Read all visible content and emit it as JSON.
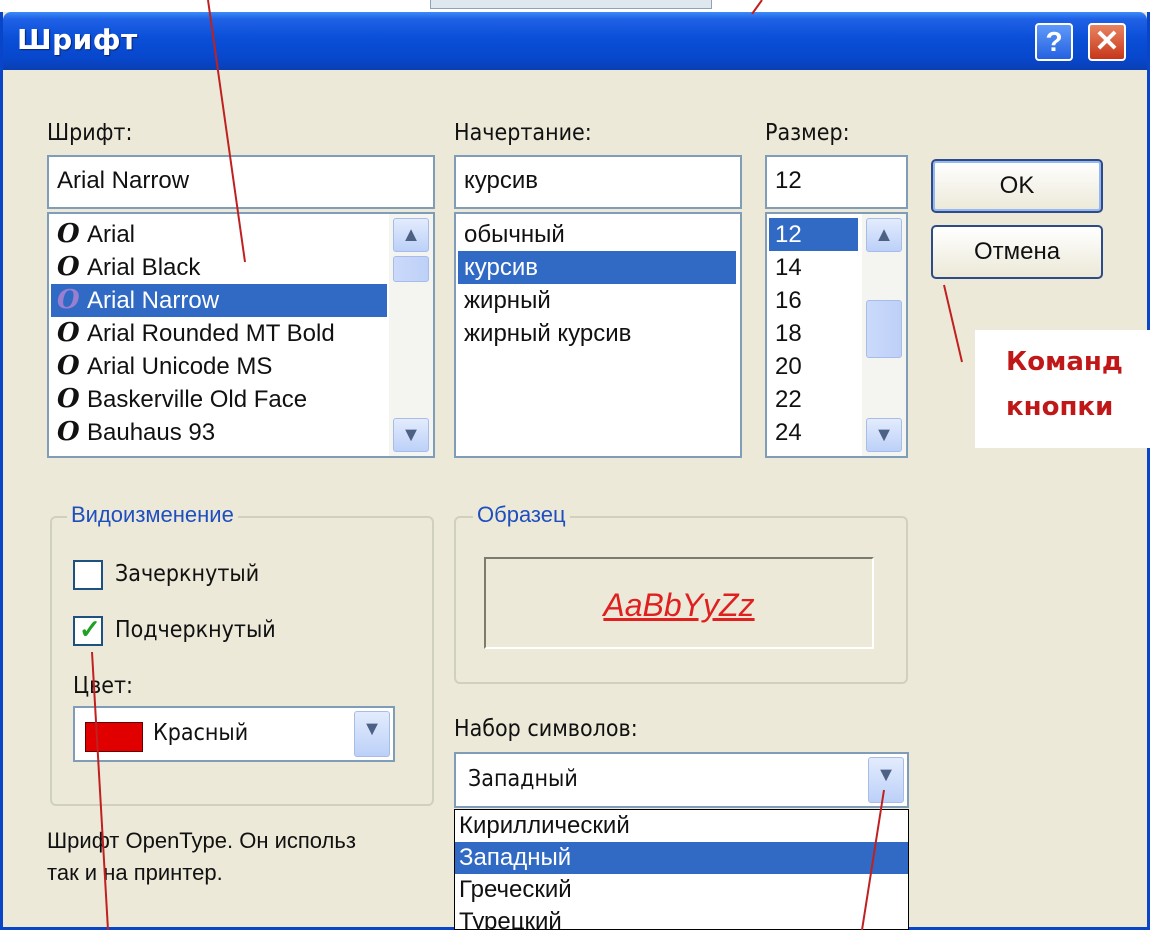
{
  "dialog": {
    "title": "Шрифт",
    "help_label": "?",
    "close_label": "✕"
  },
  "font": {
    "label": "Шрифт:",
    "value": "Arial Narrow",
    "glyph": "O",
    "items": [
      "Arial",
      "Arial Black",
      "Arial Narrow",
      "Arial Rounded MT Bold",
      "Arial Unicode MS",
      "Baskerville Old Face",
      "Bauhaus 93"
    ],
    "selected_index": 2
  },
  "style": {
    "label": "Начертание:",
    "value": "курсив",
    "items": [
      "обычный",
      "курсив",
      "жирный",
      "жирный курсив"
    ],
    "selected_index": 1
  },
  "size": {
    "label": "Размер:",
    "value": "12",
    "items": [
      "12",
      "14",
      "16",
      "18",
      "20",
      "22",
      "24"
    ],
    "selected_index": 0
  },
  "buttons": {
    "ok": "OK",
    "cancel": "Отмена"
  },
  "effects": {
    "title": "Видоизменение",
    "strikethrough": {
      "label": "Зачеркнутый",
      "checked": false
    },
    "underline": {
      "label": "Подчеркнутый",
      "checked": true
    },
    "color_label": "Цвет:",
    "color_value": "Красный",
    "color_hex": "#e00000"
  },
  "sample": {
    "title": "Образец",
    "text": "AaBbYyZz"
  },
  "charset": {
    "label": "Набор символов:",
    "value": "Западный",
    "options": [
      "Кириллический",
      "Западный",
      "Греческий",
      "Турецкий"
    ],
    "selected_index": 1
  },
  "description": {
    "line1": "Шрифт OpenType. Он использ",
    "line2": "так и на принтер."
  },
  "annotation": {
    "line1": "Команд",
    "line2": "кнопки"
  },
  "colors": {
    "title_bar": "#0a4fd8",
    "selection": "#316ac5",
    "dialog_bg": "#ece9d8",
    "annotation": "#c01818"
  }
}
